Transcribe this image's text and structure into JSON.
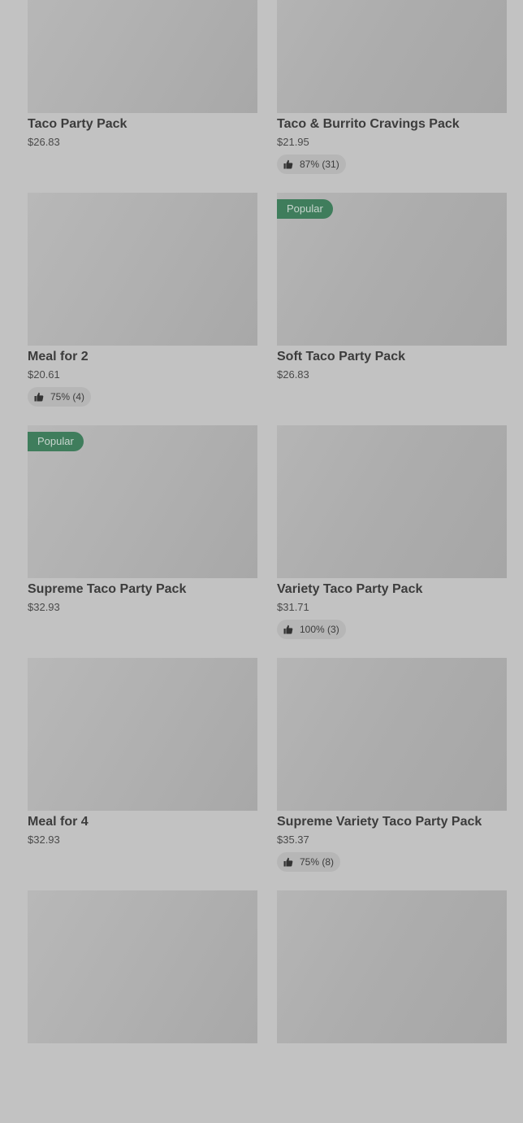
{
  "products": [
    {
      "title": "Taco Party Pack",
      "price": "$26.83",
      "badge": null,
      "rating": null
    },
    {
      "title": "Taco & Burrito Cravings Pack",
      "price": "$21.95",
      "badge": null,
      "rating": "87% (31)"
    },
    {
      "title": "Meal for 2",
      "price": "$20.61",
      "badge": null,
      "rating": "75% (4)"
    },
    {
      "title": "Soft Taco Party Pack",
      "price": "$26.83",
      "badge": "Popular",
      "rating": null
    },
    {
      "title": "Supreme Taco Party Pack",
      "price": "$32.93",
      "badge": "Popular",
      "rating": null
    },
    {
      "title": "Variety Taco Party Pack",
      "price": "$31.71",
      "badge": null,
      "rating": "100% (3)"
    },
    {
      "title": "Meal for 4",
      "price": "$32.93",
      "badge": null,
      "rating": null
    },
    {
      "title": "Supreme Variety Taco Party Pack",
      "price": "$35.37",
      "badge": null,
      "rating": "75% (8)"
    },
    {
      "title": "",
      "price": "",
      "badge": null,
      "rating": null
    },
    {
      "title": "",
      "price": "",
      "badge": null,
      "rating": null
    }
  ],
  "colors": {
    "badge_background": "#3f7d5c",
    "overlay": "#c2c2c2"
  },
  "icons": {
    "rating": "thumbs-up-icon"
  }
}
